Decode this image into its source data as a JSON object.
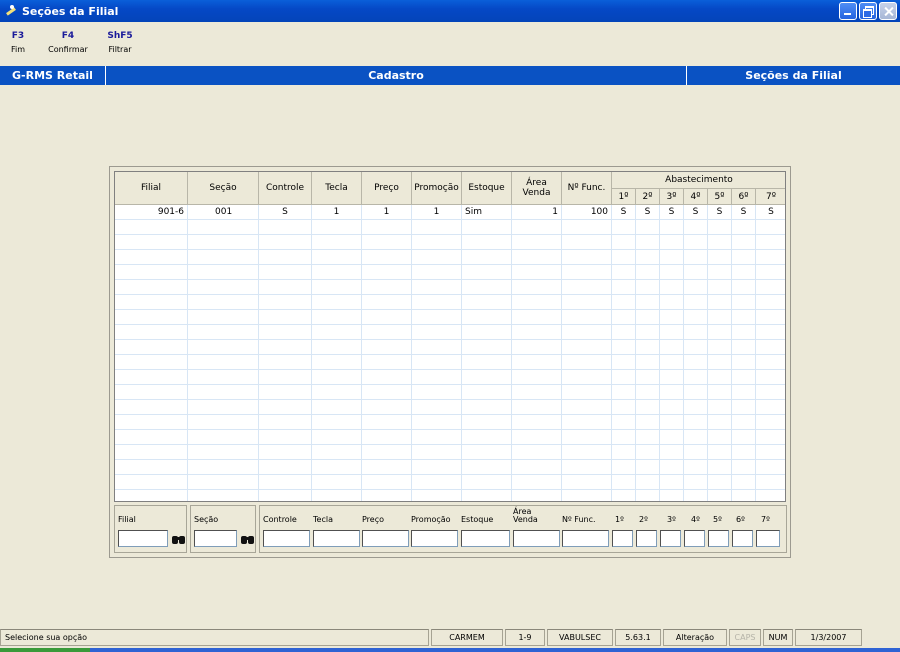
{
  "window": {
    "title": "Seções da Filial"
  },
  "fkeys": [
    {
      "key": "F3",
      "label": "Fim"
    },
    {
      "key": "F4",
      "label": "Confirmar"
    },
    {
      "key": "ShF5",
      "label": "Filtrar"
    }
  ],
  "band": {
    "app": "G-RMS Retail",
    "module": "Cadastro",
    "screen": "Seções da Filial"
  },
  "grid": {
    "headers": {
      "filial": "Filial",
      "secao": "Seção",
      "controle": "Controle",
      "tecla": "Tecla",
      "preco": "Preço",
      "promocao": "Promoção",
      "estoque": "Estoque",
      "area_l1": "Área",
      "area_l2": "Venda",
      "nfunc": "Nº Func.",
      "abastecimento": "Abastecimento",
      "days": [
        "1º",
        "2º",
        "3º",
        "4º",
        "5º",
        "6º",
        "7º"
      ]
    },
    "rows": [
      {
        "filial": "901-6",
        "secao": "001",
        "controle": "S",
        "tecla": "1",
        "preco": "1",
        "promocao": "1",
        "estoque": "Sim",
        "area": "1",
        "nfunc": "100",
        "days": [
          "S",
          "S",
          "S",
          "S",
          "S",
          "S",
          "S"
        ]
      }
    ]
  },
  "filter": {
    "filial": "Filial",
    "secao": "Seção",
    "controle": "Controle",
    "tecla": "Tecla",
    "preco": "Preço",
    "promocao": "Promoção",
    "estoque": "Estoque",
    "area": "Área Venda",
    "nfunc": "Nº Func.",
    "days": [
      "1º",
      "2º",
      "3º",
      "4º",
      "5º",
      "6º",
      "7º"
    ]
  },
  "status": {
    "message": "Selecione sua opção",
    "user": "CARMEM",
    "code": "1-9",
    "program": "VABULSEC",
    "version": "5.63.1",
    "mode": "Alteração",
    "caps": "CAPS",
    "num": "NUM",
    "date": "1/3/2007"
  }
}
